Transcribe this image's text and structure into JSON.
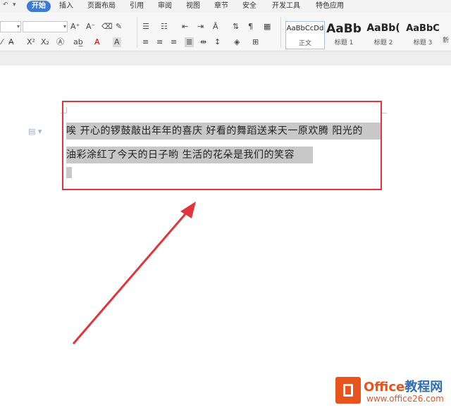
{
  "menu_tabs": {
    "home": "开始",
    "insert": "插入",
    "page_layout": "页面布局",
    "references": "引用",
    "review": "审阅",
    "view": "视图",
    "section": "章节",
    "security": "安全",
    "developer": "开发工具",
    "special": "特色应用"
  },
  "ribbon": {
    "font_grow": "A⁺",
    "font_shrink": "A⁻",
    "superscript": "X²",
    "subscript": "X₂",
    "font_color": "A",
    "char_shade": "A"
  },
  "styles": [
    {
      "preview": "AaBbCcDd",
      "name": "正文"
    },
    {
      "preview": "AaBb",
      "name": "标题 1"
    },
    {
      "preview": "AaBb(",
      "name": "标题 2"
    },
    {
      "preview": "AaBbC",
      "name": "标题 3"
    }
  ],
  "new_style_label": "新",
  "document": {
    "line1": "唉  开心的锣鼓敲出年年的喜庆  好看的舞蹈送来天一原欢腾  阳光的",
    "line2": "油彩涂红了今天的日子哟  生活的花朵是我们的笑容"
  },
  "watermark": {
    "brand_en": "Office",
    "brand_cn": "教程网",
    "url": "www.office26.com"
  },
  "colors": {
    "accent": "#3a7bd5",
    "highlight_box": "#e0353b",
    "selection": "#c8c8c8",
    "watermark": "#e8541c"
  }
}
